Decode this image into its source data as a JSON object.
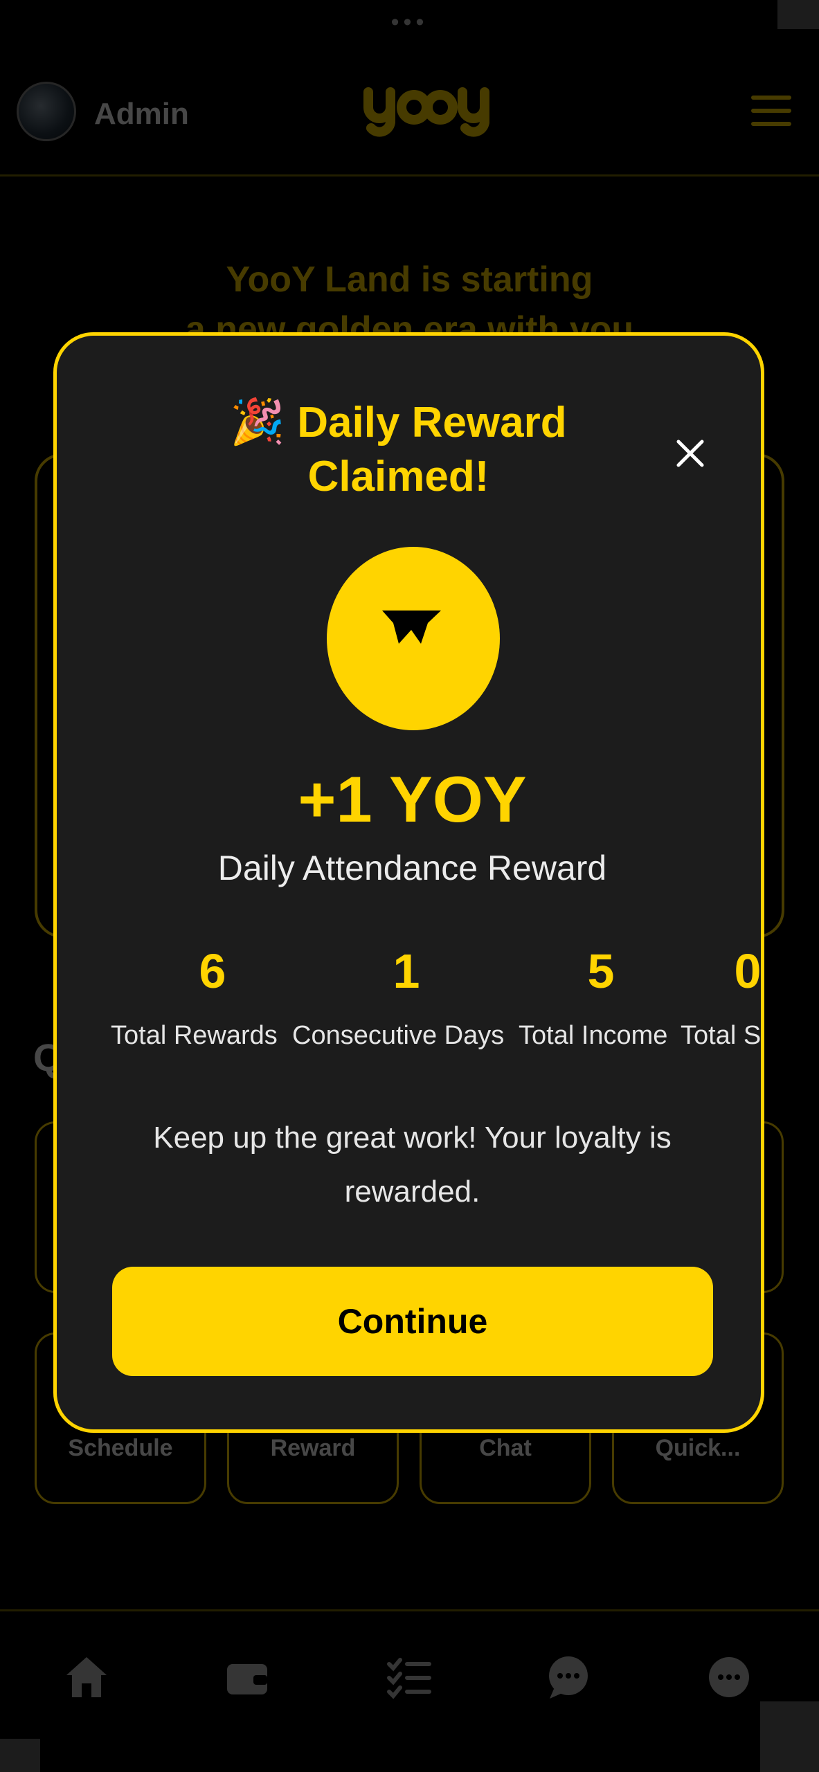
{
  "system": {
    "overflow_dots": "•••"
  },
  "header": {
    "username": "Admin",
    "logo_text": "yooy"
  },
  "background": {
    "hero_line1": "YooY Land is starting",
    "hero_line2": "a new golden era with you",
    "section_char": "Q",
    "quick_tiles": [
      {
        "label": "Schedule"
      },
      {
        "label": "Reward"
      },
      {
        "label": "Chat"
      },
      {
        "label": "Quick..."
      }
    ],
    "bottom_nav": [
      {
        "icon": "home-icon"
      },
      {
        "icon": "wallet-icon"
      },
      {
        "icon": "checklist-icon"
      },
      {
        "icon": "chat-icon"
      },
      {
        "icon": "more-icon"
      }
    ]
  },
  "modal": {
    "title_emoji": "🎉",
    "title_line1": "Daily Reward",
    "title_line2": "Claimed!",
    "amount": "+1 YOY",
    "subtitle": "Daily Attendance Reward",
    "stats": [
      {
        "value": "6",
        "label": "Total Rewards"
      },
      {
        "value": "1",
        "label": "Consecutive Days"
      },
      {
        "value": "5",
        "label": "Total Income"
      },
      {
        "value": "0",
        "label": "Total Spent"
      }
    ],
    "note": "Keep up the great work! Your loyalty is rewarded.",
    "continue_label": "Continue"
  },
  "colors": {
    "accent": "#ffd400",
    "modal_bg": "#1c1c1c",
    "page_bg": "#000000"
  }
}
